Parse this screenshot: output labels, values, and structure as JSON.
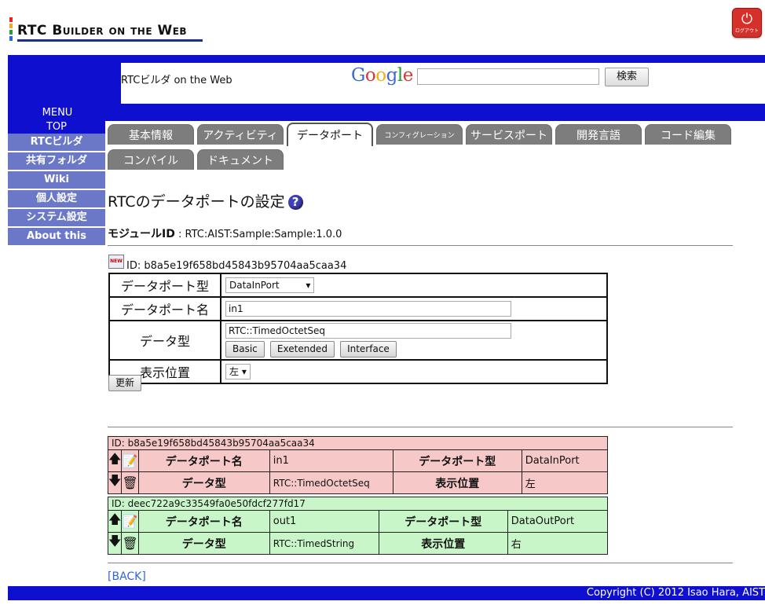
{
  "app": {
    "logo_text": "RTC Builder on the Web",
    "logout_label": "ログアウト",
    "site_title": "RTCビルダ on the Web",
    "google_logo": "Google",
    "search_button": "検索",
    "search_value": ""
  },
  "sidebar": {
    "menu_label": "MENU",
    "items": [
      "TOP",
      "RTCビルダ",
      "共有フォルダ",
      "Wiki",
      "個人設定",
      "システム設定",
      "About this"
    ]
  },
  "tabs": [
    "基本情報",
    "アクティビティ",
    "データポート",
    "コンフィグレーション",
    "サービスポート",
    "開発言語",
    "コード編集",
    "コンパイル",
    "ドキュメント"
  ],
  "active_tab": "データポート",
  "page": {
    "title": "RTCのデータポートの設定",
    "help_icon": "?",
    "module_label": "モジュールID",
    "module_value": ": RTC:AIST:Sample:Sample:1.0.0"
  },
  "form": {
    "new_icon_text": "NEW",
    "id": "ID: b8a5e19f658bd45843b95704aa5caa34",
    "port_type_label": "データポート型",
    "port_type_value": "DataInPort",
    "port_name_label": "データポート名",
    "port_name_value": "in1",
    "data_type_label": "データ型",
    "data_type_value": "RTC::TimedOctetSeq",
    "btn_basic": "Basic",
    "btn_extended": "Exetended",
    "btn_interface": "Interface",
    "position_label": "表示位置",
    "position_value": "左",
    "update_button": "更新"
  },
  "ports": [
    {
      "id": "ID: b8a5e19f658bd45843b95704aa5caa34",
      "name_label": "データポート名",
      "name": "in1",
      "type_label": "データポート型",
      "type": "DataInPort",
      "dtype_label": "データ型",
      "dtype": "RTC::TimedOctetSeq",
      "pos_label": "表示位置",
      "pos": "左"
    },
    {
      "id": "ID: deec722a9c33549fa0e50fdcf277fd17",
      "name_label": "データポート名",
      "name": "out1",
      "type_label": "データポート型",
      "type": "DataOutPort",
      "dtype_label": "データ型",
      "dtype": "RTC::TimedString",
      "pos_label": "表示位置",
      "pos": "右"
    }
  ],
  "back_link": "[BACK]",
  "footer": "Copyright (C) 2012 Isao Hara, AIST",
  "colors": {
    "header_blue": "#0f0fcf",
    "sidebar_item": "#6b78c8",
    "inport_row": "#f6c8c8",
    "outport_row": "#c8f6c8",
    "tab_gray": "#7d7d7d"
  }
}
